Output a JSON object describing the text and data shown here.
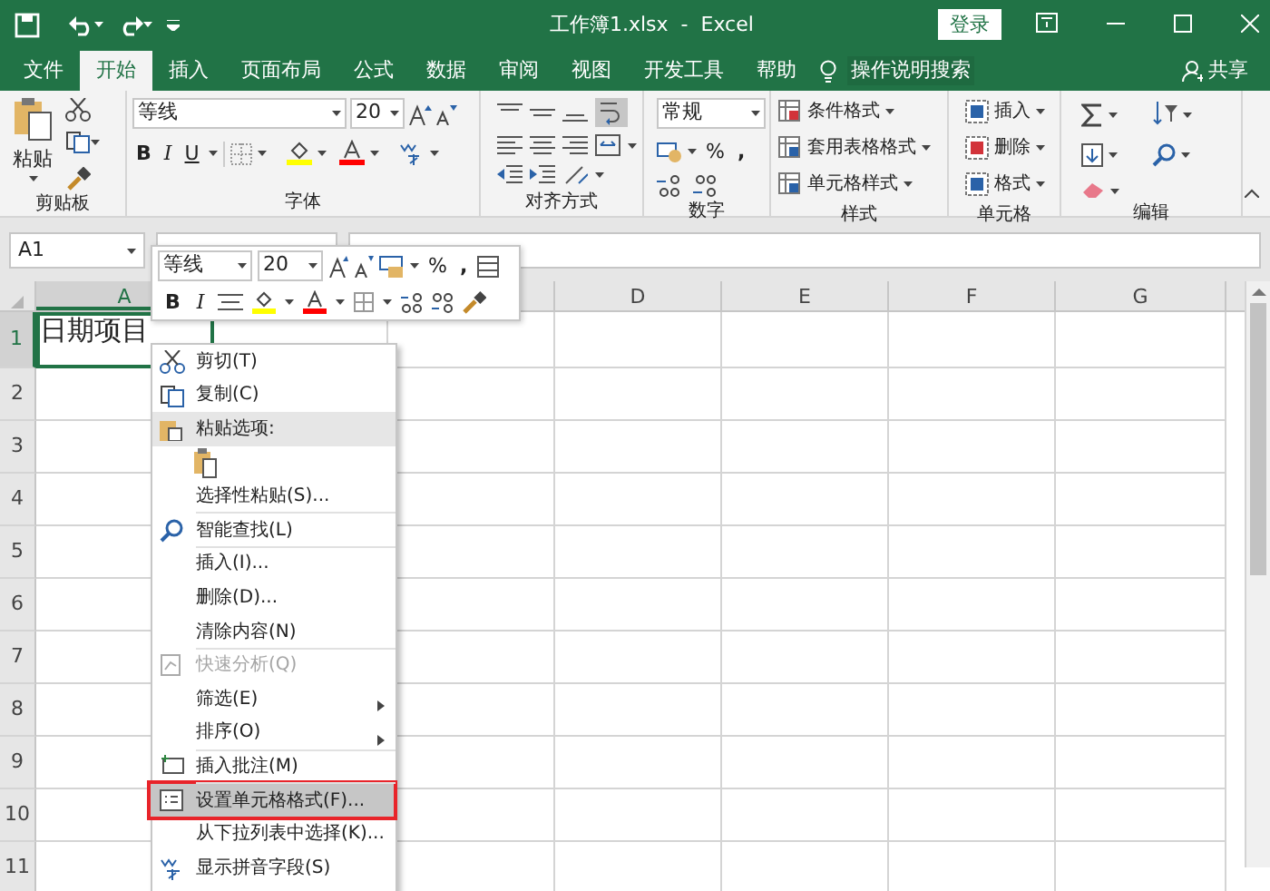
{
  "title_bar": {
    "title": "工作簿1.xlsx  -  Excel",
    "sign_in": "登录"
  },
  "ribbon_tabs": [
    {
      "label": "文件",
      "selected": false
    },
    {
      "label": "开始",
      "selected": true
    },
    {
      "label": "插入",
      "selected": false
    },
    {
      "label": "页面布局",
      "selected": false
    },
    {
      "label": "公式",
      "selected": false
    },
    {
      "label": "数据",
      "selected": false
    },
    {
      "label": "审阅",
      "selected": false
    },
    {
      "label": "视图",
      "selected": false
    },
    {
      "label": "开发工具",
      "selected": false
    },
    {
      "label": "帮助",
      "selected": false
    }
  ],
  "tell_me": "操作说明搜索",
  "share": "共享",
  "ribbon": {
    "clipboard": {
      "paste": "粘贴",
      "label": "剪贴板"
    },
    "font": {
      "name": "等线",
      "size": "20",
      "bold": "B",
      "italic": "I",
      "underline": "U",
      "label": "字体"
    },
    "alignment": {
      "label": "对齐方式",
      "wrap_on": true
    },
    "number": {
      "format": "常规",
      "percent": "%",
      "comma": ",",
      "label": "数字"
    },
    "styles": {
      "buttons": [
        "条件格式",
        "套用表格格式",
        "单元格样式"
      ],
      "label": "样式"
    },
    "cells": {
      "buttons": [
        "插入",
        "删除",
        "格式"
      ],
      "label": "单元格"
    },
    "editing": {
      "label": "编辑"
    }
  },
  "name_box": "A1",
  "mini_toolbar": {
    "font": "等线",
    "size": "20",
    "percent": "%",
    "comma": ",",
    "bold": "B",
    "italic": "I"
  },
  "columns": [
    "A",
    "D",
    "E",
    "F",
    "G"
  ],
  "rows": [
    "1",
    "2",
    "3",
    "4",
    "5",
    "6",
    "7",
    "8",
    "9",
    "10",
    "11"
  ],
  "cell_a1": "日期项目",
  "context_menu": [
    {
      "kind": "item",
      "label": "剪切(T)",
      "disabled": false,
      "selected": false
    },
    {
      "kind": "item",
      "label": "复制(C)",
      "disabled": false,
      "selected": false
    },
    {
      "kind": "header",
      "label": "粘贴选项:"
    },
    {
      "kind": "paste-options"
    },
    {
      "kind": "item",
      "label": "选择性粘贴(S)...",
      "disabled": false,
      "selected": false
    },
    {
      "kind": "separator"
    },
    {
      "kind": "item",
      "label": "智能查找(L)",
      "disabled": false,
      "selected": false
    },
    {
      "kind": "separator"
    },
    {
      "kind": "item",
      "label": "插入(I)...",
      "disabled": false,
      "selected": false
    },
    {
      "kind": "item",
      "label": "删除(D)...",
      "disabled": false,
      "selected": false
    },
    {
      "kind": "item",
      "label": "清除内容(N)",
      "disabled": false,
      "selected": false
    },
    {
      "kind": "separator"
    },
    {
      "kind": "item",
      "label": "快速分析(Q)",
      "disabled": true,
      "selected": false
    },
    {
      "kind": "submenu",
      "label": "筛选(E)",
      "disabled": false,
      "selected": false
    },
    {
      "kind": "submenu",
      "label": "排序(O)",
      "disabled": false,
      "selected": false
    },
    {
      "kind": "separator"
    },
    {
      "kind": "item",
      "label": "插入批注(M)",
      "disabled": false,
      "selected": false
    },
    {
      "kind": "separator"
    },
    {
      "kind": "item",
      "label": "设置单元格格式(F)...",
      "disabled": false,
      "selected": true,
      "annotated": true
    },
    {
      "kind": "item",
      "label": "从下拉列表中选择(K)...",
      "disabled": false,
      "selected": false
    },
    {
      "kind": "item",
      "label": "显示拼音字段(S)",
      "disabled": false,
      "selected": false
    }
  ]
}
